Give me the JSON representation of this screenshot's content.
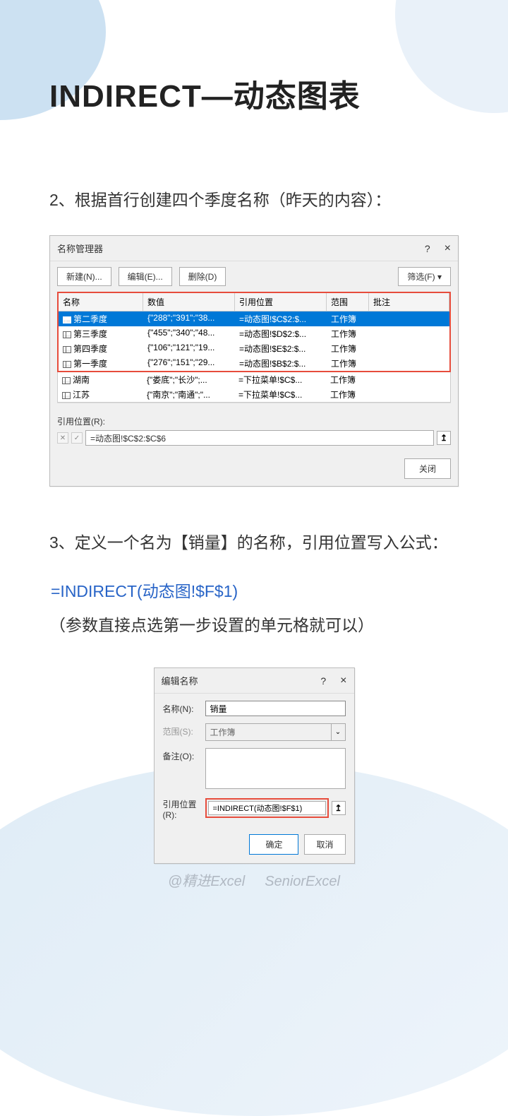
{
  "title": "INDIRECT—动态图表",
  "step2_text": "2、根据首行创建四个季度名称（昨天的内容）：",
  "step3_text": "3、定义一个名为【销量】的名称，引用位置写入公式：",
  "formula": "=INDIRECT(动态图!$F$1)",
  "note": "（参数直接点选第一步设置的单元格就可以）",
  "name_manager": {
    "title": "名称管理器",
    "help": "?",
    "close": "×",
    "btn_new": "新建(N)...",
    "btn_edit": "编辑(E)...",
    "btn_delete": "删除(D)",
    "btn_filter": "筛选(F) ▾",
    "headers": {
      "name": "名称",
      "value": "数值",
      "ref": "引用位置",
      "scope": "范围",
      "note": "批注"
    },
    "rows": [
      {
        "name": "第二季度",
        "value": "{\"288\";\"391\";\"38...",
        "ref": "=动态图!$C$2:$...",
        "scope": "工作簿",
        "selected": true
      },
      {
        "name": "第三季度",
        "value": "{\"455\";\"340\";\"48...",
        "ref": "=动态图!$D$2:$...",
        "scope": "工作簿"
      },
      {
        "name": "第四季度",
        "value": "{\"106\";\"121\";\"19...",
        "ref": "=动态图!$E$2:$...",
        "scope": "工作簿"
      },
      {
        "name": "第一季度",
        "value": "{\"276\";\"151\";\"29...",
        "ref": "=动态图!$B$2:$...",
        "scope": "工作簿"
      }
    ],
    "extra_rows": [
      {
        "name": "湖南",
        "value": "{\"娄底\";\"长沙\";...",
        "ref": "=下拉菜单!$C$...",
        "scope": "工作簿"
      },
      {
        "name": "江苏",
        "value": "{\"南京\";\"南通\";\"...",
        "ref": "=下拉菜单!$C$...",
        "scope": "工作簿"
      }
    ],
    "ref_label": "引用位置(R):",
    "ref_value": "=动态图!$C$2:$C$6",
    "btn_close": "关闭"
  },
  "edit_name": {
    "title": "编辑名称",
    "help": "?",
    "close": "×",
    "label_name": "名称(N):",
    "value_name": "销量",
    "label_scope": "范围(S):",
    "value_scope": "工作簿",
    "label_comment": "备注(O):",
    "label_ref": "引用位置(R):",
    "value_ref": "=INDIRECT(动态图!$F$1)",
    "btn_ok": "确定",
    "btn_cancel": "取消"
  },
  "watermark": {
    "handle": "@精进Excel",
    "en": "SeniorExcel"
  }
}
